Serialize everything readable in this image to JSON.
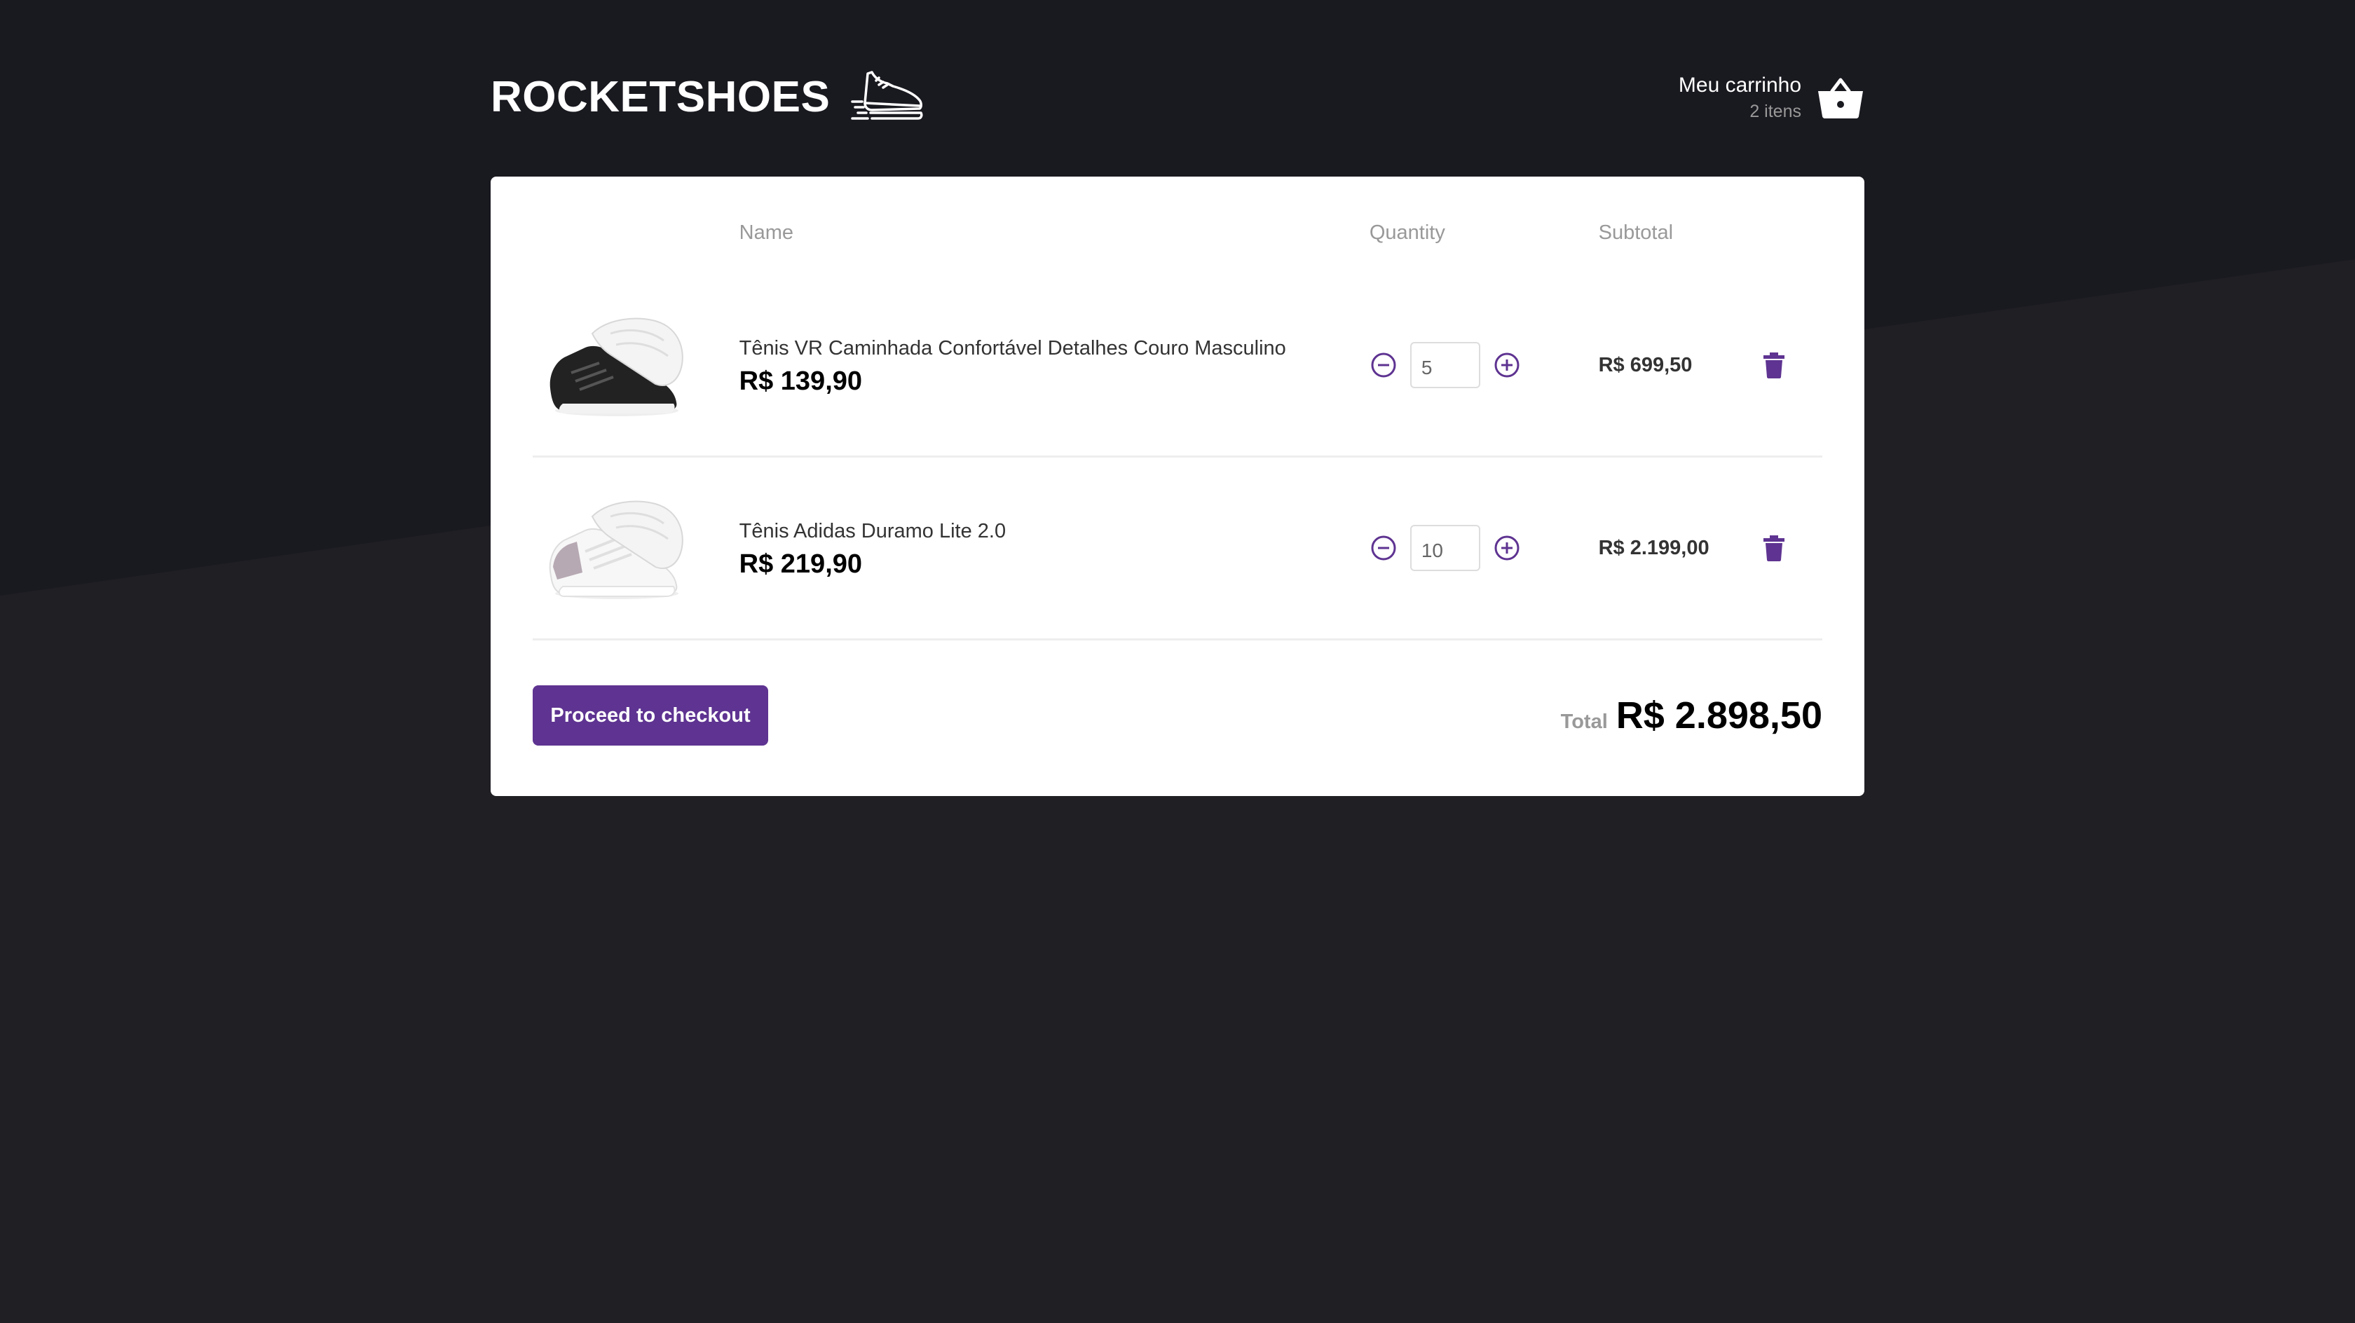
{
  "colors": {
    "background": "#191920",
    "background_band": "#1f1f24",
    "accent": "#5e3391",
    "panel": "#ffffff"
  },
  "header": {
    "logo_text": "ROCKETSHOES",
    "logo_icon": "running-shoe-icon",
    "cart_title": "Meu carrinho",
    "cart_count": "2 itens",
    "cart_icon": "basket-icon"
  },
  "table": {
    "columns": [
      "",
      "Name",
      "Quantity",
      "Subtotal",
      ""
    ],
    "rows": [
      {
        "title": "Tênis VR Caminhada Confortável Detalhes Couro Masculino",
        "price": "R$ 139,90",
        "quantity": "5",
        "subtotal": "R$ 699,50",
        "image": "black-sneaker-image"
      },
      {
        "title": "Tênis Adidas Duramo Lite 2.0",
        "price": "R$ 219,90",
        "quantity": "10",
        "subtotal": "R$ 2.199,00",
        "image": "white-sneaker-image"
      }
    ]
  },
  "footer": {
    "checkout_label": "Proceed to checkout",
    "total_label": "Total",
    "total_value": "R$ 2.898,50"
  }
}
